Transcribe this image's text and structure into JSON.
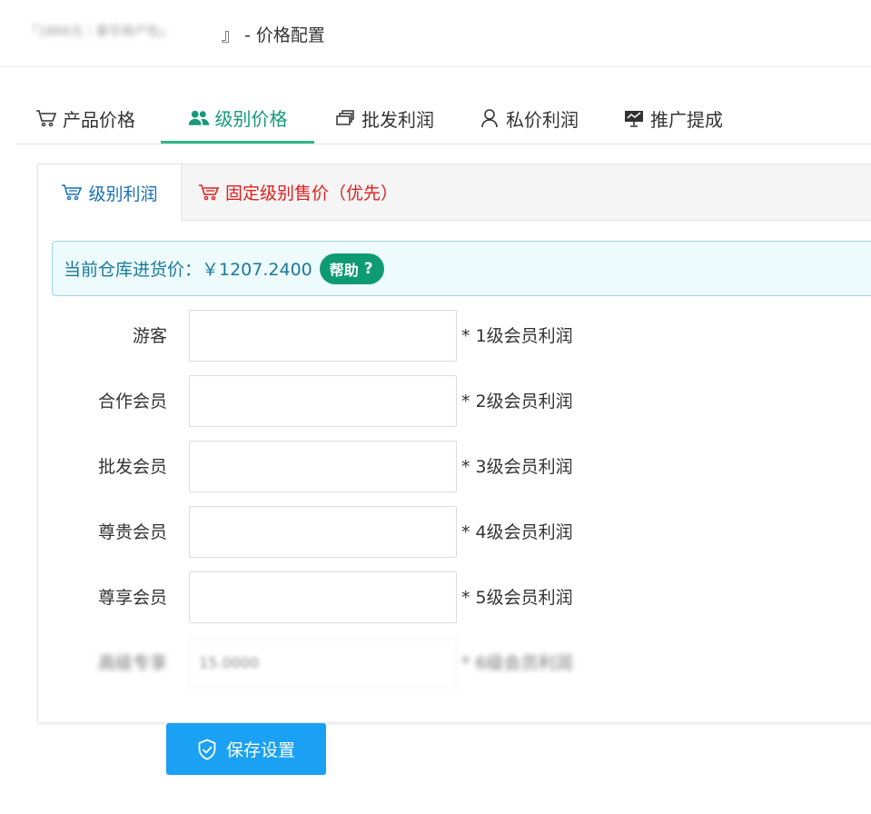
{
  "header": {
    "blurred_prefix": "「1866元｜豪华商户包」",
    "title": "』 - 价格配置"
  },
  "tabs": [
    {
      "label": "产品价格",
      "icon": "shopping-cart-icon",
      "active": false
    },
    {
      "label": "级别价格",
      "icon": "users-icon",
      "active": true
    },
    {
      "label": "批发利润",
      "icon": "stack-icon",
      "active": false
    },
    {
      "label": "私价利润",
      "icon": "user-icon",
      "active": false
    },
    {
      "label": "推广提成",
      "icon": "presentation-icon",
      "active": false
    }
  ],
  "subtabs": [
    {
      "label": "级别利润",
      "icon": "cart-icon",
      "active": true
    },
    {
      "label": "固定级别售价（优先）",
      "icon": "cart-icon",
      "active": false
    }
  ],
  "alert": {
    "text": "当前仓库进货价：￥1207.2400",
    "help_label": "帮助",
    "help_icon": "question-icon"
  },
  "form": {
    "rows": [
      {
        "label": "游客",
        "value": "",
        "hint": "* 1级会员利润"
      },
      {
        "label": "合作会员",
        "value": "",
        "hint": "* 2级会员利润"
      },
      {
        "label": "批发会员",
        "value": "",
        "hint": "* 3级会员利润"
      },
      {
        "label": "尊贵会员",
        "value": "",
        "hint": "* 4级会员利润"
      },
      {
        "label": "尊享会员",
        "value": "",
        "hint": "* 5级会员利润"
      },
      {
        "label": "高级专享",
        "value": "15.0000",
        "hint": "* 6级会员利润"
      }
    ]
  },
  "save_button": {
    "label": "保存设置",
    "icon": "shield-check-icon"
  },
  "colors": {
    "active_tab": "#16997a",
    "subtab_active": "#1a6fb5",
    "subtab_red": "#e02020",
    "alert_text": "#18799a",
    "help_badge": "#0f9b72",
    "save_button": "#1aa1f3"
  }
}
